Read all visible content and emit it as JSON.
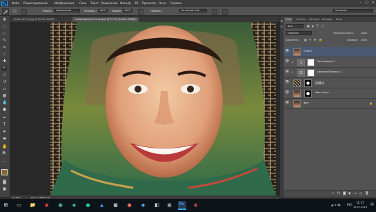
{
  "menu": {
    "logo": "Ps",
    "items": [
      "Файл",
      "Редактирование",
      "Изображение",
      "Слои",
      "Текст",
      "Выделение",
      "Фильтр",
      "3D",
      "Просмотр",
      "Окно",
      "Справка"
    ],
    "window_controls": [
      "–",
      "□",
      "✕"
    ]
  },
  "options": {
    "mode_label": "Режим:",
    "mode_value": "Нормальный",
    "opacity_label": "Непрозр.:",
    "opacity_value": "100%",
    "flow_label": "Нажим:",
    "flow_value": "100%",
    "sample_label": "Образец:",
    "sample_value": "Активный слой",
    "workspace": "Основное"
  },
  "document": {
    "tabs": [
      "00.08_2017_0.jpg @ 26.4% (RGB/8)",
      "снимок фрагмента экрана @ 72.7% (Слой 2, RGB/8)"
    ],
    "zoom": "72.69%",
    "doc_info": "Док: 13.0M/53.1M"
  },
  "panel": {
    "tabs": [
      "Слои",
      "Каналы",
      "Контуры",
      "История",
      "Инфо"
    ],
    "kind_label": "Вид",
    "blend_mode": "Обычные",
    "opacity_label": "Непрозрачность:",
    "opacity_value": "100%",
    "lock_label": "Закрепить:",
    "fill_label": "Заливка:",
    "fill_value": "100%",
    "layers": [
      {
        "name": "Слой 3",
        "selected": true,
        "thumb": "photo"
      },
      {
        "name": "Экспозиция 1",
        "selected": false,
        "thumb": "adjust"
      },
      {
        "name": "Цветовой баланс 1",
        "selected": false,
        "thumb": "adjust"
      },
      {
        "name": "Слой 1",
        "selected": false,
        "thumb": "pattern"
      },
      {
        "name": "Фон копия",
        "selected": false,
        "thumb": "photo"
      },
      {
        "name": "Фон",
        "selected": false,
        "thumb": "photo"
      }
    ]
  },
  "taskbar": {
    "lang": "РУС",
    "time": "11:17",
    "date": "10.07.2016"
  },
  "colors": {
    "accent": "#31a8ff",
    "panel_bg": "#535353",
    "selected_layer": "#4a5a72"
  }
}
